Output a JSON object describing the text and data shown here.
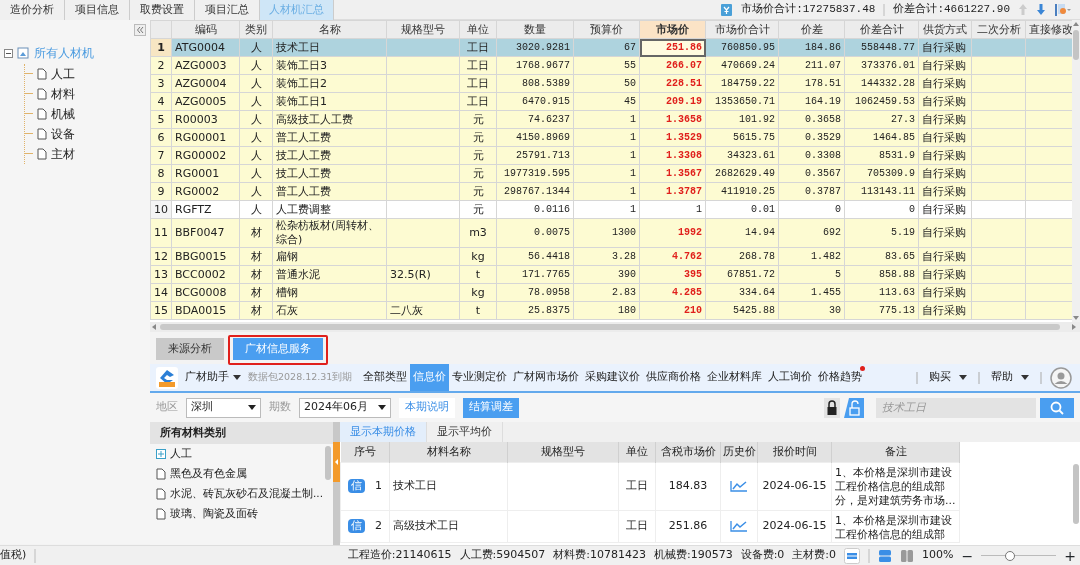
{
  "top_tabs": [
    {
      "label": "造价分析",
      "selected": false
    },
    {
      "label": "项目信息",
      "selected": false
    },
    {
      "label": "取费设置",
      "selected": false
    },
    {
      "label": "项目汇总",
      "selected": false
    },
    {
      "label": "人材机汇总",
      "selected": true
    }
  ],
  "summary": {
    "market_total": "市场价合计:17275837.48",
    "diff_total": "价差合计:4661227.90"
  },
  "sidebar": {
    "label": "所有人材机",
    "expanded": true,
    "children": [
      {
        "label": "人工"
      },
      {
        "label": "材料"
      },
      {
        "label": "机械"
      },
      {
        "label": "设备"
      },
      {
        "label": "主材"
      }
    ]
  },
  "table": {
    "columns": [
      {
        "label": "编码",
        "selected": false
      },
      {
        "label": "类别",
        "selected": false
      },
      {
        "label": "名称",
        "selected": false
      },
      {
        "label": "规格型号",
        "selected": false
      },
      {
        "label": "单位",
        "selected": false
      },
      {
        "label": "数量",
        "selected": false
      },
      {
        "label": "预算价",
        "selected": false
      },
      {
        "label": "市场价",
        "selected": true
      },
      {
        "label": "市场价合计",
        "selected": false
      },
      {
        "label": "价差",
        "selected": false
      },
      {
        "label": "价差合计",
        "selected": false
      },
      {
        "label": "供货方式",
        "selected": false
      },
      {
        "label": "二次分析",
        "selected": false
      },
      {
        "label": "直接修改",
        "selected": false
      }
    ],
    "rows": [
      {
        "no": "1",
        "code": "ATG0004",
        "category": "人",
        "name": "技术工日",
        "unit": "工日",
        "quantity": "3020.9281",
        "budget_price": "67",
        "market_price": "251.86",
        "market_total": "760850.95",
        "price_diff": "184.86",
        "diff_total": "558448.77",
        "supply": "自行采购",
        "selected": true,
        "price_changed": true
      },
      {
        "no": "2",
        "code": "AZG0003",
        "category": "人",
        "name": "装饰工日3",
        "unit": "工日",
        "quantity": "1768.9677",
        "budget_price": "55",
        "market_price": "266.07",
        "market_total": "470669.24",
        "price_diff": "211.07",
        "diff_total": "373376.01",
        "supply": "自行采购",
        "selected": false,
        "price_changed": true
      },
      {
        "no": "3",
        "code": "AZG0004",
        "category": "人",
        "name": "装饰工日2",
        "unit": "工日",
        "quantity": "808.5389",
        "budget_price": "50",
        "market_price": "228.51",
        "market_total": "184759.22",
        "price_diff": "178.51",
        "diff_total": "144332.28",
        "supply": "自行采购",
        "selected": false,
        "price_changed": true
      },
      {
        "no": "4",
        "code": "AZG0005",
        "category": "人",
        "name": "装饰工日1",
        "unit": "工日",
        "quantity": "6470.915",
        "budget_price": "45",
        "market_price": "209.19",
        "market_total": "1353650.71",
        "price_diff": "164.19",
        "diff_total": "1062459.53",
        "supply": "自行采购",
        "selected": false,
        "price_changed": true
      },
      {
        "no": "5",
        "code": "R00003",
        "category": "人",
        "name": "高级技工人工费",
        "unit": "元",
        "quantity": "74.6237",
        "budget_price": "1",
        "market_price": "1.3658",
        "market_total": "101.92",
        "price_diff": "0.3658",
        "diff_total": "27.3",
        "supply": "自行采购",
        "selected": false,
        "price_changed": true
      },
      {
        "no": "6",
        "code": "RG00001",
        "category": "人",
        "name": "普工人工费",
        "unit": "元",
        "quantity": "4150.8969",
        "budget_price": "1",
        "market_price": "1.3529",
        "market_total": "5615.75",
        "price_diff": "0.3529",
        "diff_total": "1464.85",
        "supply": "自行采购",
        "selected": false,
        "price_changed": true
      },
      {
        "no": "7",
        "code": "RG00002",
        "category": "人",
        "name": "技工人工费",
        "unit": "元",
        "quantity": "25791.713",
        "budget_price": "1",
        "market_price": "1.3308",
        "market_total": "34323.61",
        "price_diff": "0.3308",
        "diff_total": "8531.9",
        "supply": "自行采购",
        "selected": false,
        "price_changed": true
      },
      {
        "no": "8",
        "code": "RG0001",
        "category": "人",
        "name": "技工人工费",
        "unit": "元",
        "quantity": "1977319.595",
        "budget_price": "1",
        "market_price": "1.3567",
        "market_total": "2682629.49",
        "price_diff": "0.3567",
        "diff_total": "705309.9",
        "supply": "自行采购",
        "selected": false,
        "price_changed": true
      },
      {
        "no": "9",
        "code": "RG0002",
        "category": "人",
        "name": "普工人工费",
        "unit": "元",
        "quantity": "298767.1344",
        "budget_price": "1",
        "market_price": "1.3787",
        "market_total": "411910.25",
        "price_diff": "0.3787",
        "diff_total": "113143.11",
        "supply": "自行采购",
        "selected": false,
        "price_changed": true
      },
      {
        "no": "10",
        "code": "RGFTZ",
        "category": "人",
        "name": "人工费调整",
        "unit": "元",
        "quantity": "0.0116",
        "budget_price": "1",
        "market_price": "1",
        "market_total": "0.01",
        "price_diff": "0",
        "diff_total": "0",
        "supply": "自行采购",
        "selected": false,
        "price_changed": false
      },
      {
        "no": "11",
        "code": "BBF0047",
        "category": "材",
        "name": "松杂枋板材(周转材、综合)",
        "unit": "m3",
        "quantity": "0.0075",
        "budget_price": "1300",
        "market_price": "1992",
        "market_total": "14.94",
        "price_diff": "692",
        "diff_total": "5.19",
        "supply": "自行采购",
        "selected": false,
        "price_changed": true
      },
      {
        "no": "12",
        "code": "BBG0015",
        "category": "材",
        "name": "扁钢",
        "unit": "kg",
        "quantity": "56.4418",
        "budget_price": "3.28",
        "market_price": "4.762",
        "market_total": "268.78",
        "price_diff": "1.482",
        "diff_total": "83.65",
        "supply": "自行采购",
        "selected": false,
        "price_changed": true
      },
      {
        "no": "13",
        "code": "BCC0002",
        "category": "材",
        "name": "普通水泥",
        "spec": "32.5(R)",
        "unit": "t",
        "quantity": "171.7765",
        "budget_price": "390",
        "market_price": "395",
        "market_total": "67851.72",
        "price_diff": "5",
        "diff_total": "858.88",
        "supply": "自行采购",
        "selected": false,
        "price_changed": true
      },
      {
        "no": "14",
        "code": "BCG0008",
        "category": "材",
        "name": "槽钢",
        "unit": "kg",
        "quantity": "78.0958",
        "budget_price": "2.83",
        "market_price": "4.285",
        "market_total": "334.64",
        "price_diff": "1.455",
        "diff_total": "113.63",
        "supply": "自行采购",
        "selected": false,
        "price_changed": true
      },
      {
        "no": "15",
        "code": "BDA0015",
        "category": "材",
        "name": "石灰",
        "spec": "二八灰",
        "unit": "t",
        "quantity": "25.8375",
        "budget_price": "180",
        "market_price": "210",
        "market_total": "5425.88",
        "price_diff": "30",
        "diff_total": "775.13",
        "supply": "自行采购",
        "selected": false,
        "price_changed": true
      }
    ]
  },
  "bottom_tabs": [
    {
      "label": "来源分析",
      "selected": false,
      "outlined": false
    },
    {
      "label": "广材信息服务",
      "selected": true,
      "outlined": true
    }
  ],
  "toolbar": {
    "brand": "广材助手",
    "data_package": "数据包2028.12.31到期",
    "tabs": [
      {
        "label": "全部类型",
        "selected": false,
        "notification": false
      },
      {
        "label": "信息价",
        "selected": true,
        "notification": false
      },
      {
        "label": "专业测定价",
        "selected": false,
        "notification": false
      },
      {
        "label": "广材网市场价",
        "selected": false,
        "notification": false
      },
      {
        "label": "采购建议价",
        "selected": false,
        "notification": false
      },
      {
        "label": "供应商价格",
        "selected": false,
        "notification": false
      },
      {
        "label": "企业材料库",
        "selected": false,
        "notification": false
      },
      {
        "label": "人工询价",
        "selected": false,
        "notification": false
      },
      {
        "label": "价格趋势",
        "selected": false,
        "notification": true
      }
    ],
    "menus": [
      "购买",
      "帮助"
    ]
  },
  "filters": {
    "region_label": "地区",
    "region": "深圳",
    "period_label": "期数",
    "period": "2024年06月",
    "buttons": [
      {
        "label": "本期说明",
        "kind": "link"
      },
      {
        "label": "结算调差",
        "kind": "primary"
      }
    ],
    "search": {
      "placeholder": "技术工日"
    }
  },
  "categories": {
    "title": "所有材料类别",
    "items": [
      {
        "label": "人工",
        "kind": "group"
      },
      {
        "label": "黑色及有色金属",
        "kind": "leaf"
      },
      {
        "label": "水泥、砖瓦灰砂石及混凝土制...",
        "kind": "leaf"
      },
      {
        "label": "玻璃、陶瓷及面砖",
        "kind": "leaf"
      }
    ]
  },
  "price_tabs": [
    {
      "label": "显示本期价格",
      "selected": true
    },
    {
      "label": "显示平均价",
      "selected": false
    }
  ],
  "price_table": {
    "columns": [
      "序号",
      "材料名称",
      "规格型号",
      "单位",
      "含税市场价",
      "历史价",
      "报价时间",
      "备注"
    ],
    "rows": [
      {
        "badge": "信",
        "no": "1",
        "name": "技术工日",
        "unit": "工日",
        "price": "184.83",
        "date": "2024-06-15",
        "remark": "1、本价格是深圳市建设工程价格信息的组成部分，是对建筑劳务市场..."
      },
      {
        "badge": "信",
        "no": "2",
        "name": "高级技术工日",
        "unit": "工日",
        "price": "251.86",
        "date": "2024-06-15",
        "remark": "1、本价格是深圳市建设工程价格信息的组成部"
      }
    ]
  },
  "status_bar": {
    "left": "值税)",
    "items": [
      "工程造价:21140615",
      "人工费:5904507",
      "材料费:10781423",
      "机械费:190573",
      "设备费:0",
      "主材费:0"
    ],
    "zoom": "100%",
    "zoom_out": "−",
    "zoom_in": "+",
    "zoom_slider": {
      "level": 0.37
    }
  }
}
